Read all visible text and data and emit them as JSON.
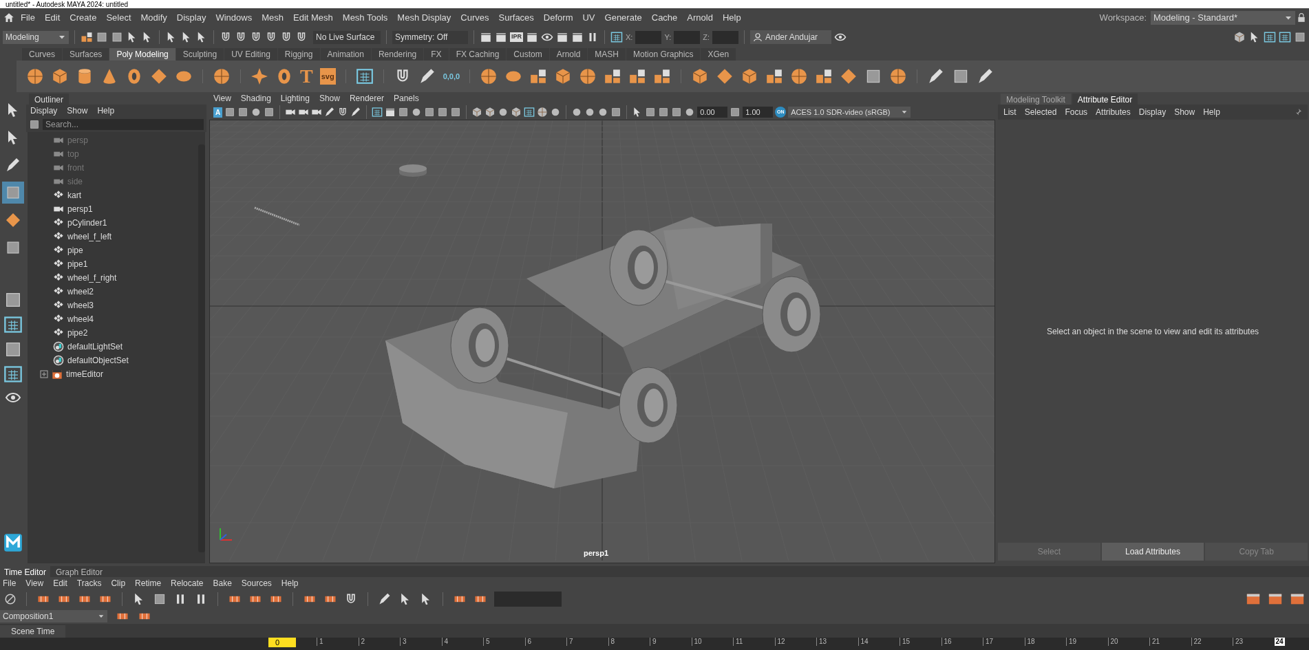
{
  "window": {
    "title": "untitled* - Autodesk MAYA 2024: untitled"
  },
  "menu_bar": [
    "File",
    "Edit",
    "Create",
    "Select",
    "Modify",
    "Display",
    "Windows",
    "Mesh",
    "Edit Mesh",
    "Mesh Tools",
    "Mesh Display",
    "Curves",
    "Surfaces",
    "Deform",
    "UV",
    "Generate",
    "Cache",
    "Arnold",
    "Help"
  ],
  "workspace": {
    "label": "Workspace:",
    "value": "Modeling - Standard*"
  },
  "status_line": {
    "mode": "Modeling",
    "live_surface": "No Live Surface",
    "symmetry": "Symmetry: Off",
    "ipr_label": "IPR",
    "x_label": "X:",
    "y_label": "Y:",
    "z_label": "Z:",
    "user": "Ander Andujar"
  },
  "shelf_tabs": [
    {
      "label": "Curves",
      "selected": false
    },
    {
      "label": "Surfaces",
      "selected": false
    },
    {
      "label": "Poly Modeling",
      "selected": true
    },
    {
      "label": "Sculpting",
      "selected": false
    },
    {
      "label": "UV Editing",
      "selected": false
    },
    {
      "label": "Rigging",
      "selected": false
    },
    {
      "label": "Animation",
      "selected": false
    },
    {
      "label": "Rendering",
      "selected": false
    },
    {
      "label": "FX",
      "selected": false
    },
    {
      "label": "FX Caching",
      "selected": false
    },
    {
      "label": "Custom",
      "selected": false
    },
    {
      "label": "Arnold",
      "selected": false
    },
    {
      "label": "MASH",
      "selected": false
    },
    {
      "label": "Motion Graphics",
      "selected": false
    },
    {
      "label": "XGen",
      "selected": false
    }
  ],
  "shelf": {
    "type_glyph": "T",
    "svg_label": "svg",
    "snap_label": "0,0,0"
  },
  "tools": [
    {
      "selected": false
    },
    {
      "selected": false
    },
    {
      "selected": false
    },
    {
      "selected": true
    },
    {
      "selected": false
    },
    {
      "selected": false
    }
  ],
  "outliner": {
    "tab": "Outliner",
    "menus": [
      "Display",
      "Show",
      "Help"
    ],
    "search_placeholder": "Search...",
    "items": [
      {
        "label": "persp",
        "kind": "camera",
        "hidden": true
      },
      {
        "label": "top",
        "kind": "camera",
        "hidden": true
      },
      {
        "label": "front",
        "kind": "camera",
        "hidden": true
      },
      {
        "label": "side",
        "kind": "camera",
        "hidden": true
      },
      {
        "label": "kart",
        "kind": "transform",
        "hidden": false
      },
      {
        "label": "persp1",
        "kind": "camera",
        "hidden": false
      },
      {
        "label": "pCylinder1",
        "kind": "transform",
        "hidden": false
      },
      {
        "label": "wheel_f_left",
        "kind": "transform",
        "hidden": false
      },
      {
        "label": "pipe",
        "kind": "transform",
        "hidden": false
      },
      {
        "label": "pipe1",
        "kind": "transform",
        "hidden": false
      },
      {
        "label": "wheel_f_right",
        "kind": "transform",
        "hidden": false
      },
      {
        "label": "wheel2",
        "kind": "transform",
        "hidden": false
      },
      {
        "label": "wheel3",
        "kind": "transform",
        "hidden": false
      },
      {
        "label": "wheel4",
        "kind": "transform",
        "hidden": false
      },
      {
        "label": "pipe2",
        "kind": "transform",
        "hidden": false
      },
      {
        "label": "defaultLightSet",
        "kind": "set",
        "hidden": false
      },
      {
        "label": "defaultObjectSet",
        "kind": "set",
        "hidden": false
      },
      {
        "label": "timeEditor",
        "kind": "editor",
        "hidden": false
      }
    ]
  },
  "viewport": {
    "menus": [
      "View",
      "Shading",
      "Lighting",
      "Show",
      "Renderer",
      "Panels"
    ],
    "a_glyph": "A",
    "exposure": "0.00",
    "gamma": "1.00",
    "on_badge": "ON",
    "color_space": "ACES 1.0 SDR-video (sRGB)",
    "camera_label": "persp1"
  },
  "attribute_panel": {
    "tabs": [
      {
        "label": "Modeling Toolkit",
        "selected": false
      },
      {
        "label": "Attribute Editor",
        "selected": true
      }
    ],
    "menus": [
      "List",
      "Selected",
      "Focus",
      "Attributes",
      "Display",
      "Show",
      "Help"
    ],
    "message": "Select an object in the scene to view and edit its attributes",
    "buttons": [
      {
        "label": "Select",
        "disabled": true
      },
      {
        "label": "Load Attributes",
        "disabled": false
      },
      {
        "label": "Copy Tab",
        "disabled": true
      }
    ]
  },
  "time_editor": {
    "tabs": [
      {
        "label": "Time Editor",
        "selected": true
      },
      {
        "label": "Graph Editor",
        "selected": false
      }
    ],
    "menus": [
      "File",
      "View",
      "Edit",
      "Tracks",
      "Clip",
      "Retime",
      "Relocate",
      "Bake",
      "Sources",
      "Help"
    ],
    "composition": "Composition1",
    "scene_time_tab": "Scene Time",
    "ruler": {
      "current": "0",
      "ticks": [
        "1",
        "2",
        "3",
        "4",
        "5",
        "6",
        "7",
        "8",
        "9",
        "10",
        "11",
        "12",
        "13",
        "14",
        "15",
        "16",
        "17",
        "18",
        "19",
        "20",
        "21",
        "22",
        "23"
      ],
      "end": "24"
    }
  }
}
